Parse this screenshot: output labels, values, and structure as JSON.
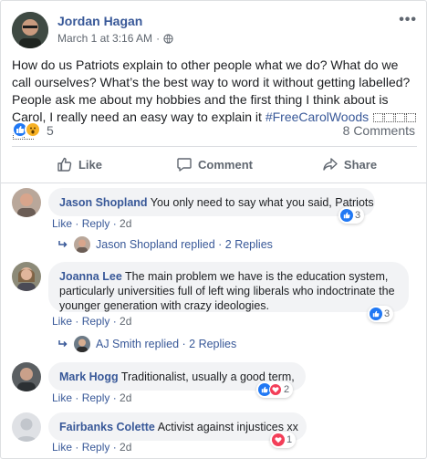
{
  "post": {
    "author": "Jordan Hagan",
    "timestamp": "March 1 at 3:16 AM",
    "separator": "·",
    "more_label": "•••",
    "text": "How do us Patriots explain to other people what we do? What do we call ourselves? What’s the best way to word it without getting labelled? People ask me about my hobbies and the first thing I think about is Carol, I really need an easy way to explain it ",
    "hashtag": "#FreeCarolWoods",
    "reaction_count": "5",
    "comment_count": "8 Comments",
    "reaction_icons": [
      "like-icon",
      "wow-icon"
    ]
  },
  "actions": {
    "like": "Like",
    "comment": "Comment",
    "share": "Share"
  },
  "comments": [
    {
      "name": "Jason Shopland",
      "text": "You only need to say what you said, Patriots",
      "like": "Like",
      "reply": "Reply",
      "time": "2d",
      "reactions": "3",
      "reply_name": "Jason Shopland",
      "replied": "replied",
      "replies": "2 Replies"
    },
    {
      "name": "Joanna Lee",
      "text": "The main problem we have is the education system, particularly universities full of left wing liberals who indoctrinate the younger generation with crazy ideologies.",
      "like": "Like",
      "reply": "Reply",
      "time": "2d",
      "reactions": "3",
      "reply_name": "AJ Smith",
      "replied": "replied",
      "replies": "2 Replies"
    },
    {
      "name": "Mark Hogg",
      "text": "Traditionalist, usually a good term,",
      "like": "Like",
      "reply": "Reply",
      "time": "2d",
      "reactions": "2"
    },
    {
      "name": "Fairbanks Colette",
      "text": "Activist against injustices xx",
      "like": "Like",
      "reply": "Reply",
      "time": "2d",
      "reactions": "1"
    }
  ],
  "colors": {
    "link": "#385898",
    "meta": "#606770",
    "like_blue": "#2078f4",
    "love_red": "#f33e58",
    "wow_yellow": "#f7b125",
    "bubble": "#f2f3f5"
  }
}
